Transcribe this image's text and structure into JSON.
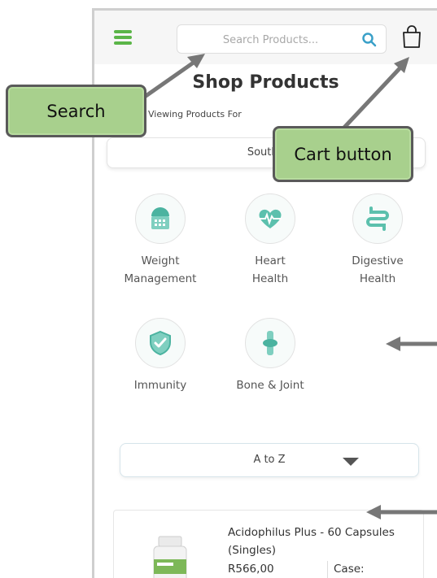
{
  "header": {
    "search_placeholder": "Search Products...",
    "icons": [
      "hamburger-menu-icon",
      "search-icon",
      "cart-icon"
    ],
    "accent_color": "#5bb548"
  },
  "page": {
    "title": "Shop Products",
    "viewing_label": "y Viewing Products For",
    "country_value": "South /"
  },
  "categories": [
    {
      "line1": "Weight",
      "line2": "Management",
      "icon": "weight-icon"
    },
    {
      "line1": "Heart",
      "line2": "Health",
      "icon": "heart-icon"
    },
    {
      "line1": "Digestive",
      "line2": "Health",
      "icon": "digestive-icon"
    },
    {
      "line1": "Immunity",
      "line2": "",
      "icon": "immunity-shield-icon"
    },
    {
      "line1": "Bone & Joint",
      "line2": "",
      "icon": "bone-joint-icon"
    }
  ],
  "sort": {
    "value": "A to Z"
  },
  "product": {
    "name": "Acidophilus Plus - 60 Capsules (Singles)",
    "price": "R566,00",
    "case_label": "Case:"
  },
  "annotations": {
    "search_callout": "Search",
    "cart_callout": "Cart button",
    "callout_color": "#a8d08d"
  }
}
